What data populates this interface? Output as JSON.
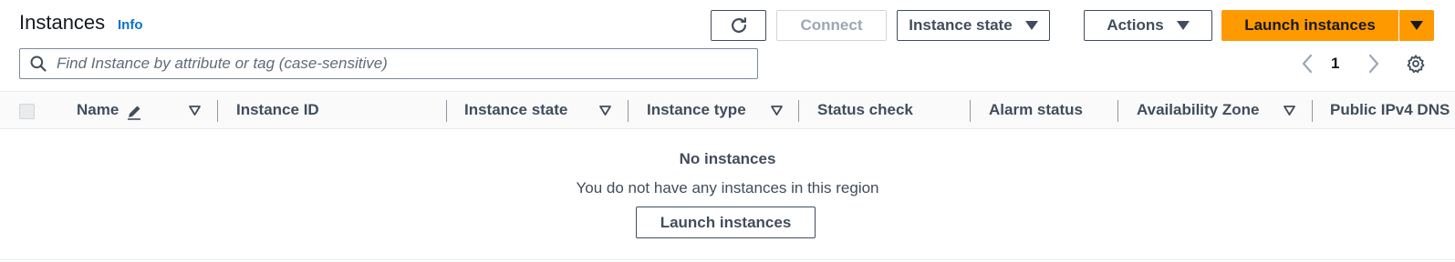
{
  "header": {
    "title": "Instances",
    "info_label": "Info"
  },
  "toolbar": {
    "refresh_icon": "refresh-icon",
    "connect_label": "Connect",
    "instance_state_label": "Instance state",
    "actions_label": "Actions",
    "launch_label": "Launch instances"
  },
  "search": {
    "placeholder": "Find Instance by attribute or tag (case-sensitive)",
    "value": ""
  },
  "pagination": {
    "current_page": "1"
  },
  "table": {
    "columns": [
      "Name",
      "Instance ID",
      "Instance state",
      "Instance type",
      "Status check",
      "Alarm status",
      "Availability Zone",
      "Public IPv4 DNS"
    ],
    "rows": []
  },
  "empty_state": {
    "title": "No instances",
    "description": "You do not have any instances in this region",
    "button_label": "Launch instances"
  },
  "colors": {
    "primary": "#ff9900",
    "link": "#0972d3",
    "text": "#16191f",
    "secondary_text": "#414d5c"
  }
}
